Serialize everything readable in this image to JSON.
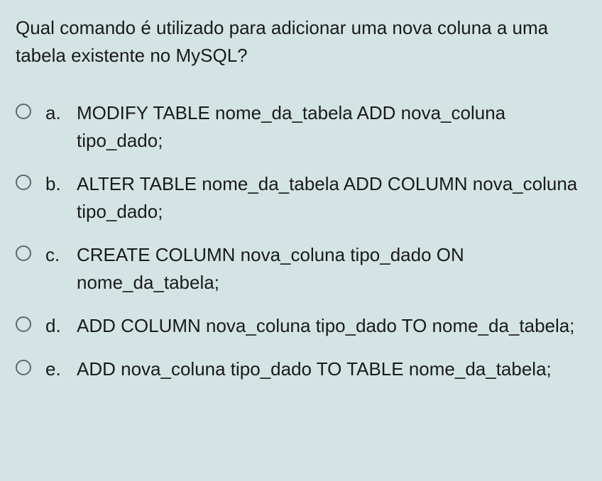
{
  "question": "Qual comando é utilizado para adicionar uma nova coluna a uma tabela existente no MySQL?",
  "options": [
    {
      "letter": "a.",
      "text": "MODIFY TABLE nome_da_tabela ADD nova_coluna tipo_dado;"
    },
    {
      "letter": "b.",
      "text": "ALTER TABLE nome_da_tabela ADD COLUMN nova_coluna tipo_dado;"
    },
    {
      "letter": "c.",
      "text": "CREATE COLUMN nova_coluna tipo_dado ON nome_da_tabela;"
    },
    {
      "letter": "d.",
      "text": "ADD COLUMN nova_coluna tipo_dado TO nome_da_tabela;"
    },
    {
      "letter": "e.",
      "text": "ADD nova_coluna tipo_dado TO TABLE nome_da_tabela;"
    }
  ]
}
